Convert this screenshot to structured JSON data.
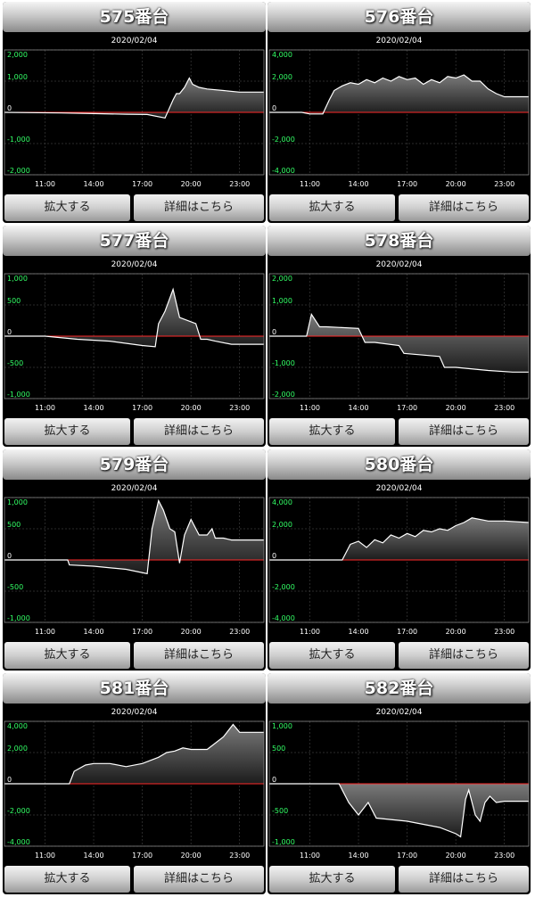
{
  "date": "2020/02/04",
  "buttons": {
    "zoom": "拡大する",
    "detail": "詳細はこちら"
  },
  "colors": {
    "line": "#ffffff",
    "zero": "#ff2a2a",
    "ytick": "#33ff66",
    "xtick": "#ffffff"
  },
  "chart_data": [
    {
      "type": "area",
      "title": "575番台",
      "xticks": [
        "11:00",
        "14:00",
        "17:00",
        "20:00",
        "23:00"
      ],
      "ylim": [
        -2000,
        2000
      ],
      "yticks": [
        2000,
        1000,
        0,
        -1000,
        -2000
      ],
      "x": [
        8.5,
        12,
        14,
        16,
        17.3,
        18.4,
        18.9,
        19.1,
        19.3,
        19.6,
        19.9,
        20.1,
        20.5,
        21,
        22,
        23,
        24.5
      ],
      "values": [
        0,
        -20,
        -40,
        -60,
        -70,
        -180,
        400,
        600,
        600,
        800,
        1100,
        900,
        800,
        750,
        700,
        650,
        650
      ]
    },
    {
      "type": "area",
      "title": "576番台",
      "xticks": [
        "11:00",
        "14:00",
        "17:00",
        "20:00",
        "23:00"
      ],
      "ylim": [
        -4000,
        4000
      ],
      "yticks": [
        4000,
        2000,
        0,
        -2000,
        -4000
      ],
      "x": [
        8.5,
        10.5,
        11,
        11.8,
        12.2,
        12.5,
        13,
        13.5,
        14,
        14.5,
        15,
        15.5,
        16,
        16.5,
        17,
        17.5,
        18,
        18.5,
        19,
        19.5,
        20,
        20.5,
        21,
        21.5,
        22,
        22.5,
        23,
        24.5
      ],
      "values": [
        0,
        0,
        -100,
        -100,
        800,
        1400,
        1700,
        1900,
        1800,
        2100,
        1900,
        2200,
        2000,
        2300,
        2100,
        2200,
        1800,
        2100,
        1900,
        2300,
        2200,
        2400,
        2000,
        2000,
        1500,
        1200,
        1000,
        1000
      ]
    },
    {
      "type": "area",
      "title": "577番台",
      "xticks": [
        "11:00",
        "14:00",
        "17:00",
        "20:00",
        "23:00"
      ],
      "ylim": [
        -1000,
        1000
      ],
      "yticks": [
        1000,
        500,
        0,
        -500,
        -1000
      ],
      "x": [
        8.5,
        11,
        13,
        15,
        17,
        17.8,
        18,
        18.4,
        18.9,
        19.3,
        20.3,
        20.6,
        21,
        21.5,
        22.5,
        24.5
      ],
      "values": [
        0,
        0,
        -50,
        -80,
        -150,
        -170,
        200,
        400,
        750,
        300,
        200,
        -50,
        -50,
        -80,
        -130,
        -130
      ]
    },
    {
      "type": "area",
      "title": "578番台",
      "xticks": [
        "11:00",
        "14:00",
        "17:00",
        "20:00",
        "23:00"
      ],
      "ylim": [
        -2000,
        2000
      ],
      "yticks": [
        2000,
        1000,
        0,
        -1000,
        -2000
      ],
      "x": [
        8.5,
        10.8,
        11.1,
        11.6,
        12,
        14,
        14.4,
        15,
        16.5,
        16.8,
        19,
        19.3,
        20,
        22,
        23.5,
        24.5
      ],
      "values": [
        0,
        0,
        700,
        300,
        300,
        250,
        -200,
        -200,
        -300,
        -550,
        -650,
        -1000,
        -1000,
        -1100,
        -1150,
        -1150
      ]
    },
    {
      "type": "area",
      "title": "579番台",
      "xticks": [
        "11:00",
        "14:00",
        "17:00",
        "20:00",
        "23:00"
      ],
      "ylim": [
        -1000,
        1000
      ],
      "yticks": [
        1000,
        500,
        0,
        -500,
        -1000
      ],
      "x": [
        8.5,
        12.4,
        12.5,
        14,
        16,
        17.3,
        17.6,
        18,
        18.3,
        18.7,
        19,
        19.3,
        19.6,
        20,
        20.5,
        21,
        21.3,
        21.5,
        22,
        22.5,
        24.5
      ],
      "values": [
        0,
        0,
        -80,
        -100,
        -150,
        -220,
        500,
        950,
        800,
        500,
        450,
        -50,
        400,
        650,
        400,
        400,
        500,
        350,
        350,
        320,
        320
      ]
    },
    {
      "type": "area",
      "title": "580番台",
      "xticks": [
        "11:00",
        "14:00",
        "17:00",
        "20:00",
        "23:00"
      ],
      "ylim": [
        -4000,
        4000
      ],
      "yticks": [
        4000,
        2000,
        0,
        -2000,
        -4000
      ],
      "x": [
        8.5,
        13,
        13.5,
        14,
        14.5,
        15,
        15.5,
        16,
        16.5,
        17,
        17.5,
        18,
        18.5,
        19,
        19.5,
        20,
        20.5,
        21,
        22,
        23,
        24.5
      ],
      "values": [
        0,
        0,
        1000,
        1200,
        800,
        1300,
        1100,
        1600,
        1400,
        1700,
        1500,
        1900,
        1800,
        2000,
        1900,
        2200,
        2400,
        2700,
        2500,
        2500,
        2400
      ]
    },
    {
      "type": "area",
      "title": "581番台",
      "xticks": [
        "11:00",
        "14:00",
        "17:00",
        "20:00",
        "23:00"
      ],
      "ylim": [
        -4000,
        4000
      ],
      "yticks": [
        4000,
        2000,
        0,
        -2000,
        -4000
      ],
      "x": [
        8.5,
        12.5,
        12.8,
        13.5,
        14,
        15,
        16,
        17,
        18,
        18.5,
        19,
        19.5,
        20,
        21,
        22,
        22.6,
        23,
        24.5
      ],
      "values": [
        0,
        0,
        800,
        1200,
        1300,
        1300,
        1100,
        1300,
        1700,
        2000,
        2100,
        2300,
        2200,
        2200,
        3000,
        3800,
        3300,
        3300
      ]
    },
    {
      "type": "area",
      "title": "582番台",
      "xticks": [
        "11:00",
        "14:00",
        "17:00",
        "20:00",
        "23:00"
      ],
      "ylim": [
        -1000,
        1000
      ],
      "yticks": [
        1000,
        500,
        0,
        -500,
        -1000
      ],
      "x": [
        8.5,
        12.8,
        13.4,
        14,
        14.6,
        15.1,
        17,
        19,
        20,
        20.3,
        20.6,
        20.8,
        21.2,
        21.5,
        21.8,
        22.1,
        22.5,
        23,
        24.5
      ],
      "values": [
        0,
        0,
        -300,
        -500,
        -300,
        -550,
        -600,
        -700,
        -800,
        -850,
        -250,
        -100,
        -500,
        -600,
        -300,
        -200,
        -300,
        -280,
        -280
      ]
    }
  ]
}
